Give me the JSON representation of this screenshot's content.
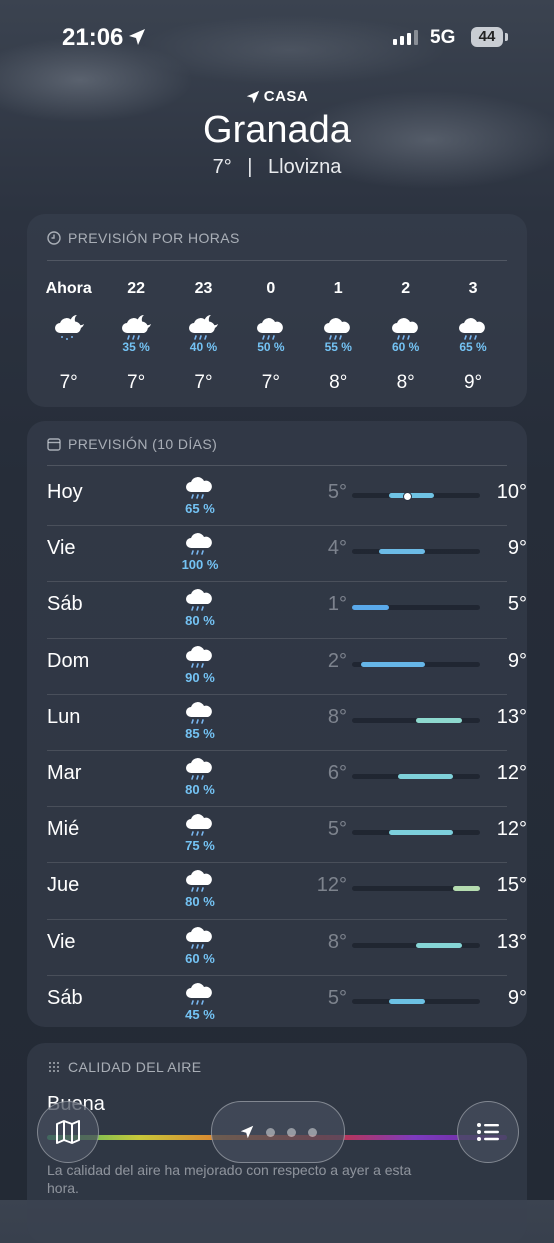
{
  "status_bar": {
    "time": "21:06",
    "network": "5G",
    "battery": "44"
  },
  "header": {
    "location_label": "CASA",
    "city": "Granada",
    "temp": "7°",
    "separator": "|",
    "condition": "Llovizna"
  },
  "hourly": {
    "title": "PREVISIÓN POR HORAS",
    "items": [
      {
        "label": "Ahora",
        "icon": "moon-drizzle-icon",
        "pct": "",
        "temp": "7°"
      },
      {
        "label": "22",
        "icon": "moon-rain-cloud-icon",
        "pct": "35 %",
        "temp": "7°"
      },
      {
        "label": "23",
        "icon": "moon-rain-cloud-icon",
        "pct": "40 %",
        "temp": "7°"
      },
      {
        "label": "0",
        "icon": "rain-cloud-icon",
        "pct": "50 %",
        "temp": "7°"
      },
      {
        "label": "1",
        "icon": "rain-cloud-icon",
        "pct": "55 %",
        "temp": "8°"
      },
      {
        "label": "2",
        "icon": "rain-cloud-icon",
        "pct": "60 %",
        "temp": "8°"
      },
      {
        "label": "3",
        "icon": "rain-cloud-icon",
        "pct": "65 %",
        "temp": "9°"
      }
    ]
  },
  "daily": {
    "title": "PREVISIÓN (10 DÍAS)",
    "range_min": 1,
    "range_max": 15,
    "current_temp": 7,
    "days": [
      {
        "name": "Hoy",
        "pct": "65 %",
        "low": "5°",
        "high": "10°",
        "low_val": 5,
        "high_val": 10,
        "color": "#6fc3e4",
        "show_now": true
      },
      {
        "name": "Vie",
        "pct": "100 %",
        "low": "4°",
        "high": "9°",
        "low_val": 4,
        "high_val": 9,
        "color": "#6cbbe6",
        "show_now": false
      },
      {
        "name": "Sáb",
        "pct": "80 %",
        "low": "1°",
        "high": "5°",
        "low_val": 1,
        "high_val": 5,
        "color": "#5aa9ea",
        "show_now": false
      },
      {
        "name": "Dom",
        "pct": "90 %",
        "low": "2°",
        "high": "9°",
        "low_val": 2,
        "high_val": 9,
        "color": "#66b6e8",
        "show_now": false
      },
      {
        "name": "Lun",
        "pct": "85 %",
        "low": "8°",
        "high": "13°",
        "low_val": 8,
        "high_val": 13,
        "color": "#8ed9cf",
        "show_now": false
      },
      {
        "name": "Mar",
        "pct": "80 %",
        "low": "6°",
        "high": "12°",
        "low_val": 6,
        "high_val": 12,
        "color": "#7fd1da",
        "show_now": false
      },
      {
        "name": "Mié",
        "pct": "75 %",
        "low": "5°",
        "high": "12°",
        "low_val": 5,
        "high_val": 12,
        "color": "#7ccfdc",
        "show_now": false
      },
      {
        "name": "Jue",
        "pct": "80 %",
        "low": "12°",
        "high": "15°",
        "low_val": 12,
        "high_val": 15,
        "color": "#b5dcb0",
        "show_now": false
      },
      {
        "name": "Vie",
        "pct": "60 %",
        "low": "8°",
        "high": "13°",
        "low_val": 8,
        "high_val": 13,
        "color": "#86d5d6",
        "show_now": false
      },
      {
        "name": "Sáb",
        "pct": "45 %",
        "low": "5°",
        "high": "9°",
        "low_val": 5,
        "high_val": 9,
        "color": "#6cc1e4",
        "show_now": false
      }
    ]
  },
  "air_quality": {
    "title": "CALIDAD DEL AIRE",
    "status": "Buena",
    "note": "La calidad del aire ha mejorado con respecto a ayer a esta hora."
  },
  "bottom_bar": {
    "map_icon": "map-icon",
    "list_icon": "list-icon",
    "location_icon": "location-arrow-icon"
  }
}
